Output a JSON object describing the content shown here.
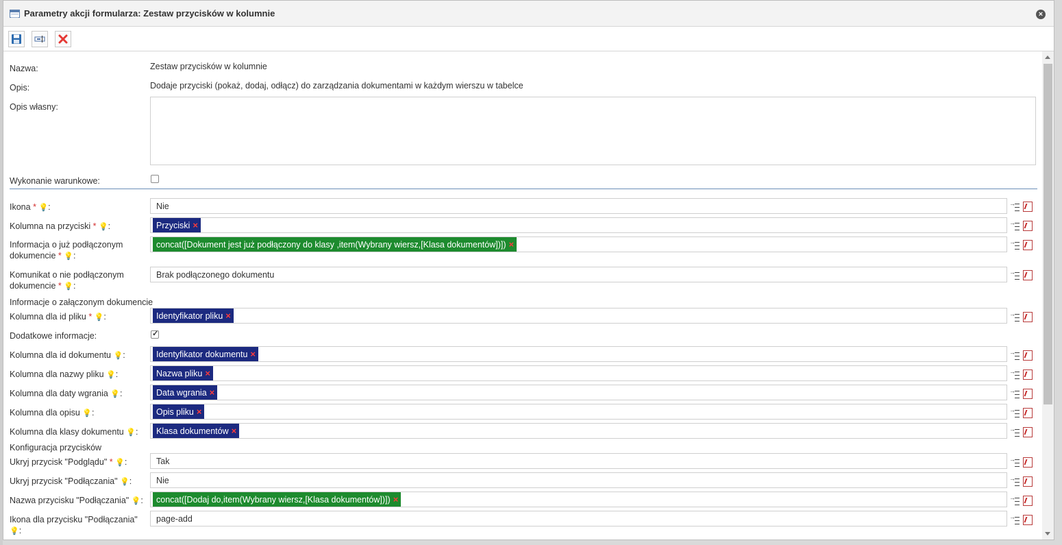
{
  "dialog": {
    "title": "Parametry akcji formularza: Zestaw przycisków w kolumnie",
    "close_symbol": "×"
  },
  "toolbar": {
    "icons": [
      "save-icon",
      "edit-field-icon",
      "delete-icon"
    ]
  },
  "form": {
    "nazwa": {
      "label": "Nazwa:",
      "value": "Zestaw przycisków w kolumnie"
    },
    "opis": {
      "label": "Opis:",
      "value": "Dodaje przyciski (pokaż, dodaj, odłącz) do zarządzania dokumentami w każdym wierszu w tabelce"
    },
    "opis_wlasny": {
      "label": "Opis własny:",
      "value": ""
    },
    "wykonanie": {
      "label": "Wykonanie warunkowe:",
      "checked": false
    },
    "ikona": {
      "label": "Ikona",
      "value": "Nie"
    },
    "kolumna_przyciski": {
      "label": "Kolumna na przyciski",
      "tag": "Przyciski"
    },
    "info_podlaczony": {
      "label_line1": "Informacja o już podłączonym",
      "label_line2": "dokumencie",
      "tag": "concat([Dokument jest już podłączony do klasy ,item(Wybrany wiersz,[Klasa dokumentów])])"
    },
    "komunikat": {
      "label_line1": "Komunikat o nie podłączonym",
      "label_line2": "dokumencie",
      "value": "Brak podłączonego dokumentu"
    },
    "section_zalaczony": "Informacje o załączonym dokumencie",
    "id_pliku": {
      "label": "Kolumna dla id pliku",
      "tag": "Identyfikator pliku"
    },
    "dodatkowe": {
      "label": "Dodatkowe informacje:",
      "checked": true
    },
    "id_dokumentu": {
      "label": "Kolumna dla id dokumentu",
      "tag": "Identyfikator dokumentu"
    },
    "nazwa_pliku": {
      "label": "Kolumna dla nazwy pliku",
      "tag": "Nazwa pliku"
    },
    "data_wgrania": {
      "label": "Kolumna dla daty wgrania",
      "tag": "Data wgrania"
    },
    "opis_kol": {
      "label": "Kolumna dla opisu",
      "tag": "Opis pliku"
    },
    "klasa": {
      "label": "Kolumna dla klasy dokumentu",
      "tag": "Klasa dokumentów"
    },
    "section_konfig": "Konfiguracja przycisków",
    "ukryj_podgladu": {
      "label": "Ukryj przycisk \"Podglądu\"",
      "value": "Tak"
    },
    "ukryj_podlaczania": {
      "label": "Ukryj przycisk \"Podłączania\"",
      "value": "Nie"
    },
    "nazwa_przycisku": {
      "label": "Nazwa przycisku \"Podłączania\"",
      "tag": "concat([Dodaj do,item(Wybrany wiersz,[Klasa dokumentów])])"
    },
    "ikona_przycisku": {
      "label_line1": "Ikona dla przycisku \"Podłączania\"",
      "value": "page-add"
    }
  },
  "common": {
    "required_mark": "*",
    "colon": ":",
    "bulb": "💡",
    "tag_remove": "×"
  },
  "colors": {
    "tag_blue": "#1c2a80",
    "tag_green": "#1d8b2e",
    "remove_red": "#ff3b3b"
  }
}
